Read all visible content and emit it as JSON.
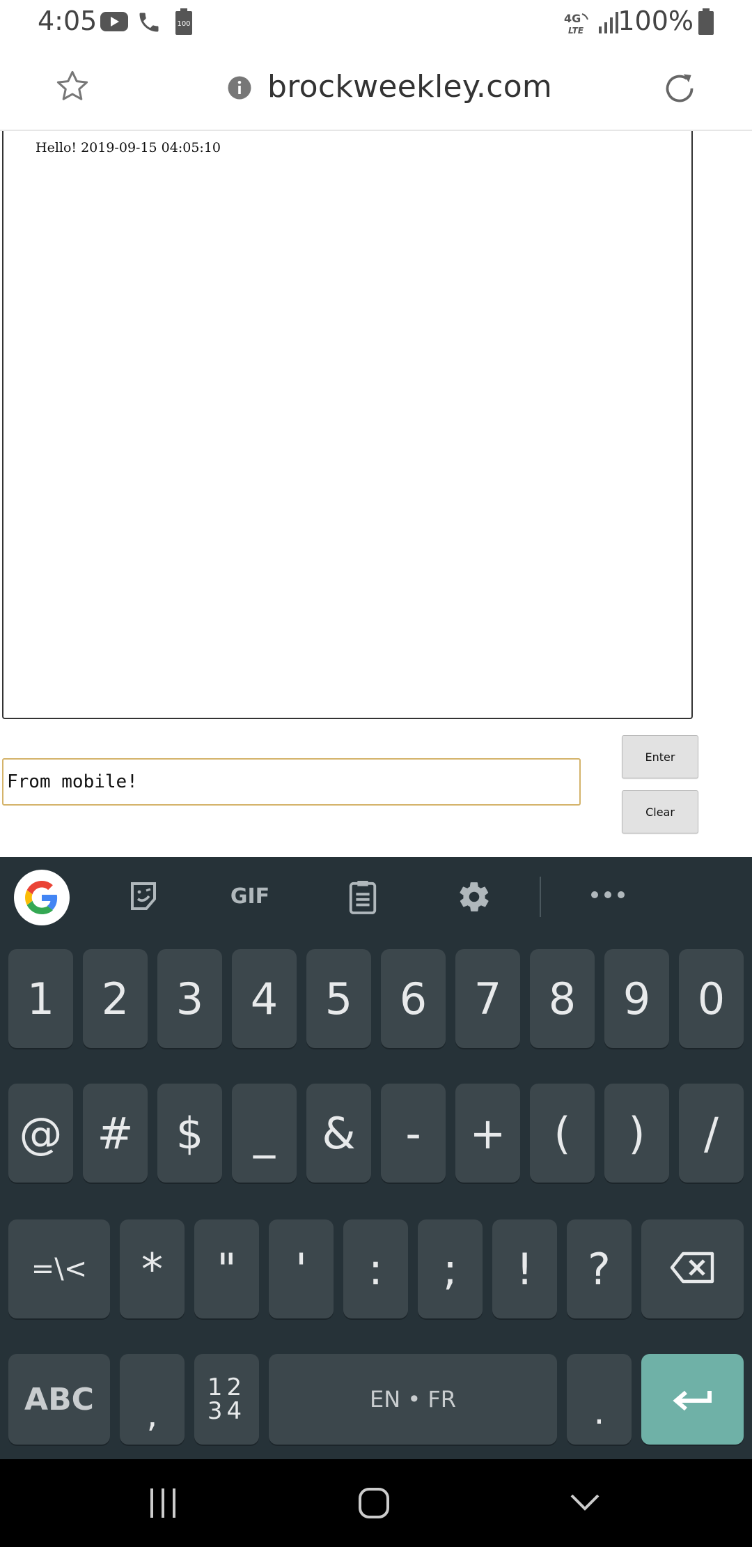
{
  "status_bar": {
    "time": "4:05",
    "battery": "100%",
    "icons": [
      "youtube-icon",
      "phone-icon",
      "battery-saver-icon",
      "lte-icon",
      "signal-icon",
      "battery-icon"
    ],
    "icon_color": "#555555"
  },
  "url_bar": {
    "url": "brockweekley.com",
    "icons": [
      "star-icon",
      "info-icon",
      "reload-icon"
    ]
  },
  "page": {
    "chat_log": "Hello! 2019-09-15 04:05:10",
    "message_input_value": "From mobile!",
    "enter_button": "Enter",
    "clear_button": "Clear",
    "input_border_color": "#d4b36a"
  },
  "keyboard": {
    "background": "#263238",
    "key_color": "#3c474c",
    "enter_color": "#6fb1a7",
    "toolbar": [
      "google-icon",
      "sticker-icon",
      "gif-icon",
      "clipboard-icon",
      "settings-icon",
      "more-icon"
    ],
    "gif_label": "GIF",
    "row1": [
      "1",
      "2",
      "3",
      "4",
      "5",
      "6",
      "7",
      "8",
      "9",
      "0"
    ],
    "row2": [
      "@",
      "#",
      "$",
      "_",
      "&",
      "-",
      "+",
      "(",
      ")",
      "/"
    ],
    "row3": [
      "=\\<",
      "*",
      "\"",
      "'",
      ":",
      ";",
      "!",
      "?"
    ],
    "row4": {
      "abc": "ABC",
      "comma": ",",
      "numpad_top": "12",
      "numpad_bottom": "34",
      "space": "EN • FR",
      "period": "."
    }
  },
  "nav_bar": {
    "icons": [
      "recents-icon",
      "home-icon",
      "hide-keyboard-icon"
    ]
  }
}
